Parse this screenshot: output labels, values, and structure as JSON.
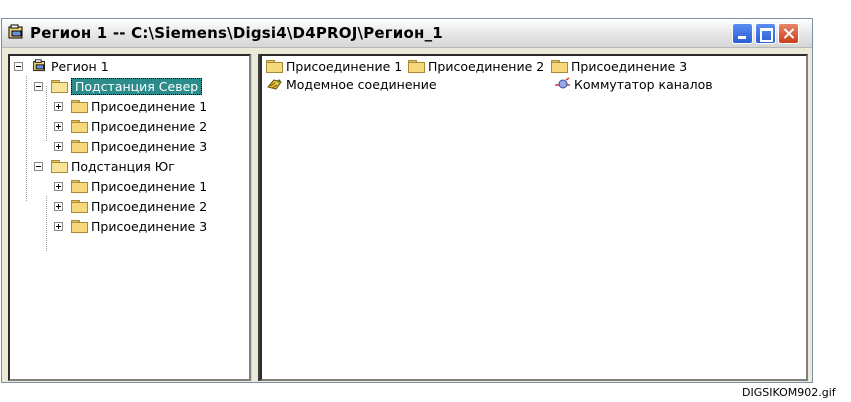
{
  "window": {
    "title": "Регион 1 -- C:\\Siemens\\Digsi4\\D4PROJ\\Регион_1"
  },
  "tree": {
    "root": "Регион 1",
    "nodes": [
      {
        "label": "Подстанция Север",
        "selected": true,
        "children": [
          "Присоединение 1",
          "Присоединение 2",
          "Присоединение 3"
        ]
      },
      {
        "label": "Подстанция Юг",
        "selected": false,
        "children": [
          "Присоединение 1",
          "Присоединение 2",
          "Присоединение 3"
        ]
      }
    ]
  },
  "list": {
    "items": [
      "Присоединение 1",
      "Присоединение 2",
      "Присоединение 3"
    ],
    "modem": "Модемное соединение",
    "switch": "Коммутатор каналов"
  },
  "caption": "DIGSIKOM902.gif",
  "colors": {
    "selection": "#2c8c8c",
    "folder": "#f5d97a"
  },
  "icons": [
    "project-icon",
    "folder-icon",
    "modem-icon",
    "channel-switch-icon",
    "expand-icon",
    "collapse-icon"
  ]
}
